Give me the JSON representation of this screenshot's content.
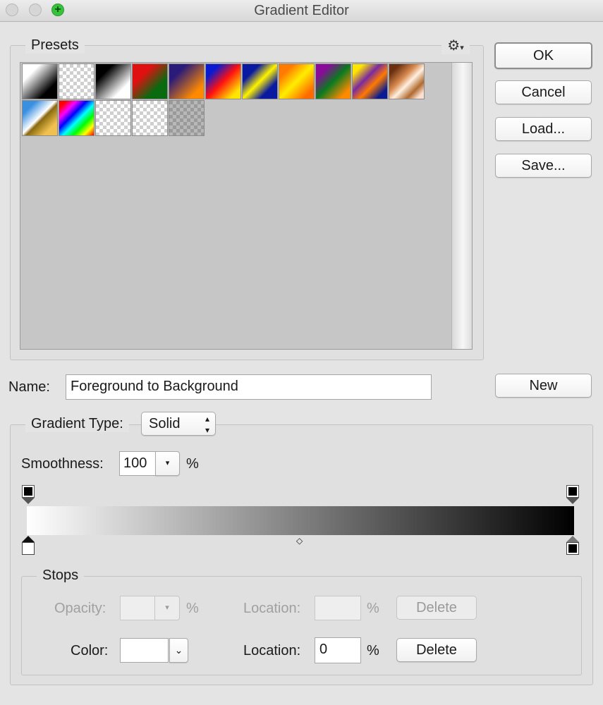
{
  "window": {
    "title": "Gradient Editor"
  },
  "presets": {
    "label": "Presets",
    "swatches": [
      {
        "name": "preset-foreground-to-background",
        "bg": "linear-gradient(135deg,#ffffff 25%,#000000 75%)"
      },
      {
        "name": "preset-foreground-to-transparent",
        "bg": "checker-white"
      },
      {
        "name": "preset-black-white",
        "bg": "linear-gradient(135deg,#000000 25%,#ffffff 75%)"
      },
      {
        "name": "preset-red-green",
        "bg": "linear-gradient(135deg,#e01010 30%,#0a6a10 70%)"
      },
      {
        "name": "preset-violet-orange",
        "bg": "linear-gradient(135deg,#2a1a7a 25%,#ff8a00 80%)"
      },
      {
        "name": "preset-blue-red-yellow",
        "bg": "linear-gradient(135deg,#0a1ad0 20%,#ff1010 50%,#ffe600 85%)"
      },
      {
        "name": "preset-blue-yellow-blue",
        "bg": "linear-gradient(135deg,#0a1aa0 25%,#fff200 50%,#0a1aa0 75%)"
      },
      {
        "name": "preset-orange-yellow-orange",
        "bg": "linear-gradient(135deg,#ff7a00 20%,#ffee00 50%,#ff6a00 85%)"
      },
      {
        "name": "preset-violet-green-orange",
        "bg": "linear-gradient(135deg,#8a0a9a 20%,#0a7a20 50%,#ff8a00 85%)"
      },
      {
        "name": "preset-yellow-violet-orange-blue",
        "bg": "linear-gradient(135deg,#ffe600 15%,#7a2aa0 40%,#ff7a00 60%,#0a1a90 85%)"
      },
      {
        "name": "preset-copper",
        "bg": "linear-gradient(135deg,#6a3010 15%,#d98a50 40%,#fff0e0 55%,#b06a30 75%,#fbe0d0 90%)"
      },
      {
        "name": "preset-chrome",
        "bg": "linear-gradient(135deg,#3a90e0 20%,#ffffff 48%,#8a6a10 55%,#f0c050 80%)"
      },
      {
        "name": "preset-spectrum",
        "bg": "linear-gradient(135deg,#ff0000 10%,#ff00ff 25%,#0000ff 40%,#00ffff 55%,#00ff00 70%,#ffff00 85%,#ff0000 100%)"
      },
      {
        "name": "preset-transparent-rainbow",
        "bg": "checker-rainbow"
      },
      {
        "name": "preset-transparent-stripes",
        "bg": "checker-stripes"
      },
      {
        "name": "preset-neutral-density",
        "bg": "checker-gray"
      }
    ]
  },
  "buttons": {
    "ok": "OK",
    "cancel": "Cancel",
    "load": "Load...",
    "save": "Save...",
    "new": "New"
  },
  "name": {
    "label": "Name:",
    "value": "Foreground to Background"
  },
  "gradient": {
    "type_label": "Gradient Type:",
    "type_value": "Solid",
    "smoothness_label": "Smoothness:",
    "smoothness_value": "100",
    "smoothness_unit": "%",
    "start_color": "#ffffff",
    "end_color": "#000000",
    "midpoint": 50
  },
  "stops": {
    "label": "Stops",
    "opacity_label": "Opacity:",
    "opacity_value": "",
    "opacity_unit": "%",
    "opacity_location_label": "Location:",
    "opacity_location_value": "",
    "opacity_location_unit": "%",
    "opacity_delete": "Delete",
    "color_label": "Color:",
    "color_value": "#ffffff",
    "color_location_label": "Location:",
    "color_location_value": "0",
    "color_location_unit": "%",
    "color_delete": "Delete"
  }
}
